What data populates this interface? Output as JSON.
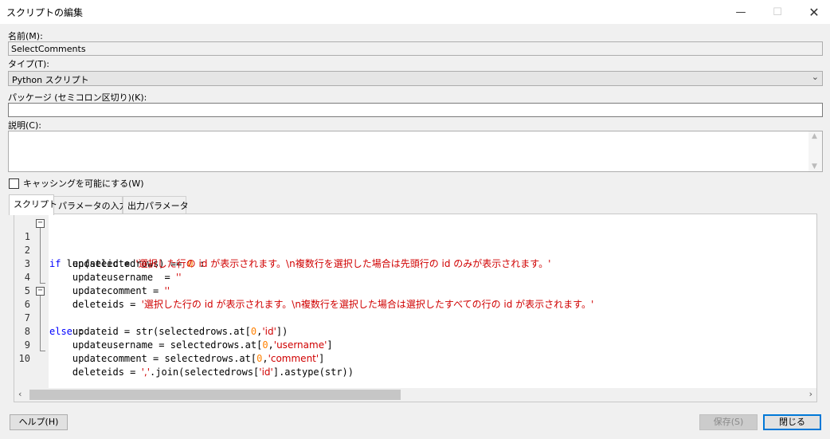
{
  "window": {
    "title": "スクリプトの編集",
    "minimize": "—",
    "maximize": "☐",
    "close": "✕"
  },
  "form": {
    "name_label": "名前(M):",
    "name_value": "SelectComments",
    "type_label": "タイプ(T):",
    "type_value": "Python スクリプト",
    "package_label": "パッケージ (セミコロン区切り)(K):",
    "package_value": "",
    "description_label": "説明(C):",
    "description_value": "",
    "caching_label": "キャッシングを可能にする(W)",
    "caching_checked": false
  },
  "tabs": [
    {
      "label": "スクリプト",
      "active": true
    },
    {
      "label": "パラメータの入力",
      "active": false
    },
    {
      "label": "出力パラメータ",
      "active": false
    }
  ],
  "code_lines": [
    {
      "n": "1",
      "text": "if len(selectedrows) == 0 :"
    },
    {
      "n": "2",
      "text": "    updateid = '選択した行の id が表示されます。\\n複数行を選択した場合は先頭行の id のみが表示されます。'"
    },
    {
      "n": "3",
      "text": "    updateusername  = ''"
    },
    {
      "n": "4",
      "text": "    updatecomment = ''"
    },
    {
      "n": "5",
      "text": "    deleteids = '選択した行の id が表示されます。\\n複数行を選択した場合は選択したすべての行の id が表示されます。'"
    },
    {
      "n": "6",
      "text": "else :"
    },
    {
      "n": "7",
      "text": "    updateid = str(selectedrows.at[0,'id'])"
    },
    {
      "n": "8",
      "text": "    updateusername = selectedrows.at[0,'username']"
    },
    {
      "n": "9",
      "text": "    updatecomment = selectedrows.at[0,'comment']"
    },
    {
      "n": "10",
      "text": "    deleteids = ','.join(selectedrows['id'].astype(str))"
    }
  ],
  "buttons": {
    "help": "ヘルプ(H)",
    "save": "保存(S)",
    "close": "閉じる"
  },
  "icons": {
    "dropdown": "chevron-down-icon",
    "scroll_left": "chevron-left-icon",
    "scroll_right": "chevron-right-icon",
    "fold": "fold-toggle-icon"
  },
  "colors": {
    "keyword": "#0000ff",
    "string": "#d00000",
    "number": "#ff8000",
    "focus_border": "#0078d7"
  }
}
